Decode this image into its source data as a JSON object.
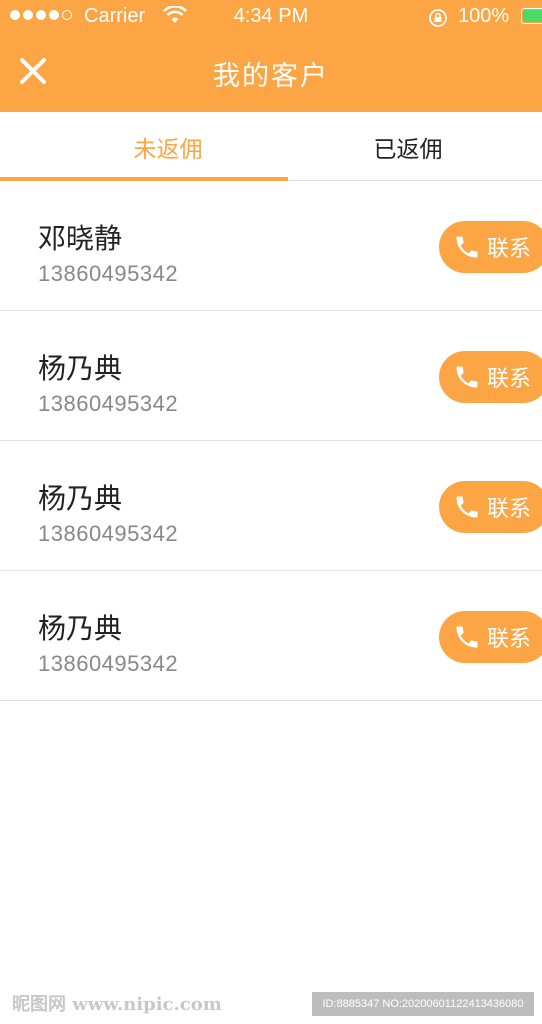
{
  "status_bar": {
    "carrier": "Carrier",
    "time": "4:34 PM",
    "battery": "100%"
  },
  "header": {
    "title": "我的客户"
  },
  "tabs": [
    {
      "label": "未返佣"
    },
    {
      "label": "已返佣"
    }
  ],
  "customers": [
    {
      "name": "邓晓静",
      "phone": "13860495342",
      "action": "联系"
    },
    {
      "name": "杨乃典",
      "phone": "13860495342",
      "action": "联系"
    },
    {
      "name": "杨乃典",
      "phone": "13860495342",
      "action": "联系"
    },
    {
      "name": "杨乃典",
      "phone": "13860495342",
      "action": "联系"
    }
  ],
  "watermark": {
    "logo": "昵图网 www.nipic.com",
    "id": "ID:8885347 NO:20200601122413436080"
  },
  "colors": {
    "accent": "#FCA544",
    "battery": "#4CD964"
  }
}
